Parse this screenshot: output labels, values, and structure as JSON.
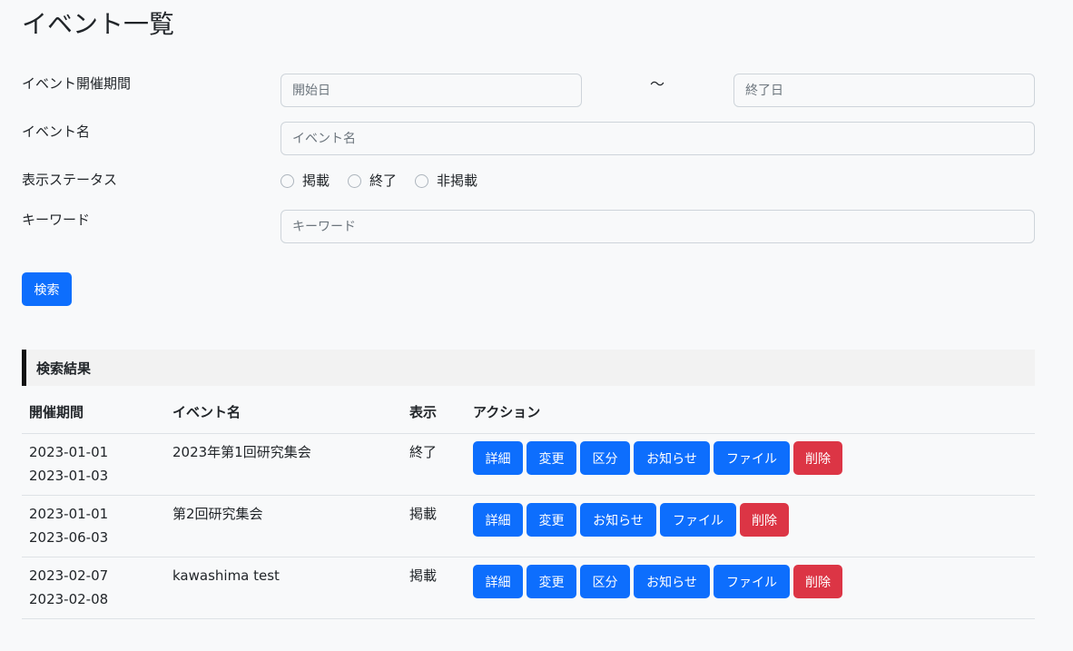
{
  "page": {
    "title": "イベント一覧"
  },
  "search_form": {
    "period": {
      "label": "イベント開催期間",
      "start_placeholder": "開始日",
      "end_placeholder": "終了日",
      "separator": "〜"
    },
    "event_name": {
      "label": "イベント名",
      "placeholder": "イベント名"
    },
    "status": {
      "label": "表示ステータス",
      "options": [
        "掲載",
        "終了",
        "非掲載"
      ]
    },
    "keyword": {
      "label": "キーワード",
      "placeholder": "キーワード"
    },
    "search_button": "検索"
  },
  "results": {
    "section_title": "検索結果",
    "columns": [
      "開催期間",
      "イベント名",
      "表示",
      "アクション"
    ],
    "rows": [
      {
        "start": "2023-01-01",
        "end": "2023-01-03",
        "name": "2023年第1回研究集会",
        "status": "終了",
        "actions": [
          "詳細",
          "変更",
          "区分",
          "お知らせ",
          "ファイル",
          "削除"
        ]
      },
      {
        "start": "2023-01-01",
        "end": "2023-06-03",
        "name": "第2回研究集会",
        "status": "掲載",
        "actions": [
          "詳細",
          "変更",
          "お知らせ",
          "ファイル",
          "削除"
        ]
      },
      {
        "start": "2023-02-07",
        "end": "2023-02-08",
        "name": "kawashima test",
        "status": "掲載",
        "actions": [
          "詳細",
          "変更",
          "区分",
          "お知らせ",
          "ファイル",
          "削除"
        ]
      }
    ]
  },
  "colors": {
    "primary": "#0d6efd",
    "danger": "#dc3545",
    "background": "#f8f9fa",
    "section_header_bg": "#f2f2f2"
  }
}
